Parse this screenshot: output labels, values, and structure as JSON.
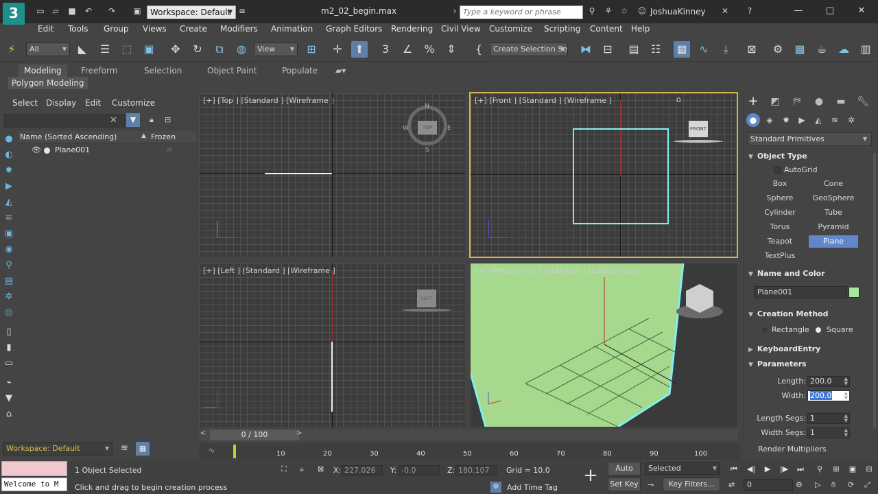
{
  "titlebar": {
    "logo": "3",
    "workspace": "Workspace: Default",
    "file_title": "m2_02_begin.max",
    "search_placeholder": "Type a keyword or phrase",
    "user": "JoshuaKinney"
  },
  "menu": [
    "Edit",
    "Tools",
    "Group",
    "Views",
    "Create",
    "Modifiers",
    "Animation",
    "Graph Editors",
    "Rendering",
    "Civil View",
    "Customize",
    "Scripting",
    "Content",
    "Help"
  ],
  "toolbar": {
    "filter": "All",
    "ref_coord": "View",
    "selection_set": "Create Selection Se"
  },
  "ribbon": {
    "tabs": [
      "Modeling",
      "Freeform",
      "Selection",
      "Object Paint",
      "Populate"
    ],
    "panel": "Polygon Modeling"
  },
  "scene_explorer": {
    "menu": [
      "Select",
      "Display",
      "Edit",
      "Customize"
    ],
    "col_name": "Name (Sorted Ascending)",
    "col_frozen": "Frozen",
    "objects": [
      "Plane001"
    ],
    "workspace": "Workspace: Default"
  },
  "viewports": {
    "top": "[+] [Top ] [Standard ] [Wireframe ]",
    "front": "[+] [Front ] [Standard ] [Wireframe ]",
    "left": "[+] [Left ] [Standard ] [Wireframe ]",
    "perspective": "[+] [Perspective ] [Standard ] [Edged Faces ]",
    "cube_top": "TOP",
    "cube_front": "FRONT",
    "cube_left": "LEFT",
    "compass_n": "N",
    "compass_s": "S",
    "compass_e": "E",
    "compass_w": "W"
  },
  "command_panel": {
    "primitive_type": "Standard Primitives",
    "object_type_title": "Object Type",
    "autogrid": "AutoGrid",
    "primitives": [
      "Box",
      "Cone",
      "Sphere",
      "GeoSphere",
      "Cylinder",
      "Tube",
      "Torus",
      "Pyramid",
      "Teapot",
      "Plane",
      "TextPlus"
    ],
    "selected_primitive": "Plane",
    "name_color_title": "Name and Color",
    "object_name": "Plane001",
    "object_color": "#a8e89a",
    "creation_method_title": "Creation Method",
    "method_rectangle": "Rectangle",
    "method_square": "Square",
    "keyboard_entry_title": "KeyboardEntry",
    "parameters_title": "Parameters",
    "length_label": "Length:",
    "length_value": "200.0",
    "width_label": "Width:",
    "width_value": "200.0",
    "length_segs_label": "Length Segs:",
    "length_segs_value": "1",
    "width_segs_label": "Width Segs:",
    "width_segs_value": "1",
    "render_multipliers": "Render Multipliers"
  },
  "timeline": {
    "frame_display": "0 / 100",
    "ticks": [
      "10",
      "20",
      "30",
      "40",
      "50",
      "60",
      "70",
      "80",
      "90",
      "100"
    ]
  },
  "status": {
    "maxscript": "Welcome to M",
    "selected_count": "1 Object Selected",
    "prompt": "Click and drag to begin creation process",
    "x_label": "X:",
    "x_value": "227.026",
    "y_label": "Y:",
    "y_value": "-0.0",
    "z_label": "Z:",
    "z_value": "180.107",
    "grid": "Grid = 10.0",
    "add_time_tag": "Add Time Tag",
    "auto_key": "Auto Key",
    "set_key": "Set Key",
    "key_mode": "Selected",
    "key_filters": "Key Filters...",
    "current_frame": "0"
  },
  "colors": {
    "selection_cyan": "#7ff0f0",
    "plane_green": "#a6d88e",
    "active_border": "#d6b550",
    "selected_button": "#5f87c9"
  }
}
